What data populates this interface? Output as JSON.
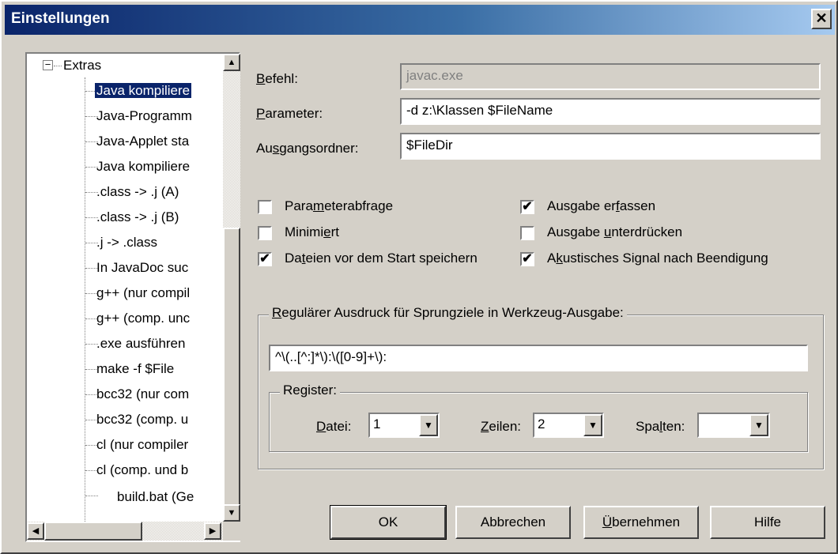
{
  "window": {
    "title": "Einstellungen",
    "close_glyph": "✕"
  },
  "tree": {
    "root": {
      "expander": "−",
      "label": "Extras"
    },
    "items": [
      "Java kompiliere",
      "Java-Programm",
      "Java-Applet sta",
      "Java kompiliere",
      ".class -> .j (A)",
      ".class -> .j (B)",
      ".j -> .class",
      "In JavaDoc suc",
      "g++ (nur compil",
      "g++ (comp. unc",
      ".exe ausführen",
      "make -f $File",
      "bcc32 (nur com",
      "bcc32 (comp. u",
      "cl (nur compiler",
      "cl (comp. und b",
      "build.bat (Ge"
    ],
    "selected_index": 0,
    "scroll": {
      "up": "▲",
      "down": "▼",
      "left": "◀",
      "right": "▶"
    }
  },
  "form": {
    "befehl": {
      "label_u": "B",
      "label_rest": "efehl:",
      "value": "javac.exe"
    },
    "parameter": {
      "label_u": "P",
      "label_rest": "arameter:",
      "value": "-d z:\\Klassen $FileName"
    },
    "ausgang": {
      "label_pre": "Au",
      "label_u": "s",
      "label_rest": "gangsordner:",
      "value": "$FileDir"
    }
  },
  "checkboxes": {
    "parameterabfrage": {
      "pre": "Para",
      "u": "m",
      "post": "eterabfrage",
      "checked": false
    },
    "minimiert": {
      "pre": "Minimi",
      "u": "e",
      "post": "rt",
      "checked": false
    },
    "dateien": {
      "pre": "Da",
      "u": "t",
      "post": "eien vor dem Start speichern",
      "checked": true
    },
    "ausgabe_erfassen": {
      "pre": "Ausgabe er",
      "u": "f",
      "post": "assen",
      "checked": true
    },
    "ausgabe_unterdruecken": {
      "pre": "Ausgabe ",
      "u": "u",
      "post": "nterdrücken",
      "checked": false
    },
    "akustisch": {
      "pre": "A",
      "u": "k",
      "post": "ustisches Signal nach Beendigung",
      "checked": true
    },
    "check_mark": "✔"
  },
  "regex": {
    "title_u": "R",
    "title_rest": "egulärer Ausdruck für Sprungziele in Werkzeug-Ausgabe:",
    "value": "^\\(..[^:]*\\):\\([0-9]+\\):"
  },
  "register": {
    "title": "Register:",
    "datei": {
      "u": "D",
      "rest": "atei:",
      "value": "1"
    },
    "zeilen": {
      "u": "Z",
      "rest": "eilen:",
      "value": "2"
    },
    "spalten": {
      "pre": "Spa",
      "u": "l",
      "rest": "ten:",
      "value": ""
    },
    "arrow": "▼"
  },
  "buttons": {
    "ok": "OK",
    "abbrechen": "Abbrechen",
    "uebernehmen_u": "Ü",
    "uebernehmen_rest": "bernehmen",
    "hilfe": "Hilfe"
  }
}
